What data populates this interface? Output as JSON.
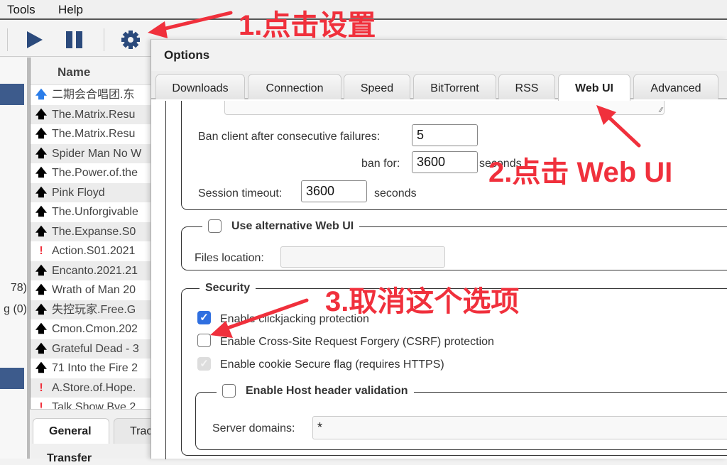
{
  "menu": {
    "items": [
      "Tools",
      "Help"
    ]
  },
  "toolbar": {
    "play": "play-icon",
    "pause": "pause-icon",
    "settings": "gear-icon"
  },
  "sidebar": {
    "count_a": "78)",
    "count_b": "g (0)"
  },
  "list": {
    "header": "Name",
    "rows": [
      {
        "status": "up-blue",
        "name": "二期会合唱团.东"
      },
      {
        "status": "up",
        "name": "The.Matrix.Resu"
      },
      {
        "status": "up",
        "name": "The.Matrix.Resu"
      },
      {
        "status": "up",
        "name": "Spider Man No W"
      },
      {
        "status": "up",
        "name": "The.Power.of.the"
      },
      {
        "status": "up",
        "name": "Pink Floyd"
      },
      {
        "status": "up",
        "name": "The.Unforgivable"
      },
      {
        "status": "up",
        "name": "The.Expanse.S0"
      },
      {
        "status": "error",
        "name": "Action.S01.2021"
      },
      {
        "status": "up",
        "name": "Encanto.2021.21"
      },
      {
        "status": "up",
        "name": "Wrath of Man 20"
      },
      {
        "status": "up",
        "name": "失控玩家.Free.G"
      },
      {
        "status": "up",
        "name": "Cmon.Cmon.202"
      },
      {
        "status": "up",
        "name": "Grateful Dead - 3"
      },
      {
        "status": "up",
        "name": "71 Into the Fire 2"
      },
      {
        "status": "error",
        "name": "A.Store.of.Hope."
      },
      {
        "status": "error",
        "name": "Talk Show Bye 2"
      }
    ]
  },
  "bottom": {
    "tabs": [
      "General",
      "Trac"
    ],
    "section": "Transfer"
  },
  "dialog": {
    "title": "Options",
    "tabs": [
      "Downloads",
      "Connection",
      "Speed",
      "BitTorrent",
      "RSS",
      "Web UI",
      "Advanced"
    ],
    "active_tab": "Web UI",
    "ban_failures_label": "Ban client after consecutive failures:",
    "ban_failures_value": "5",
    "ban_for_label": "ban for:",
    "ban_for_value": "3600",
    "ban_for_unit": "seconds",
    "session_timeout_label": "Session timeout:",
    "session_timeout_value": "3600",
    "session_timeout_unit": "seconds",
    "alt_webui_label": "Use alternative Web UI",
    "alt_webui_checked": false,
    "files_location_label": "Files location:",
    "files_location_value": "",
    "security_legend": "Security",
    "clickjacking_label": "Enable clickjacking protection",
    "clickjacking_checked": true,
    "csrf_label": "Enable Cross-Site Request Forgery (CSRF) protection",
    "csrf_checked": false,
    "cookie_secure_label": "Enable cookie Secure flag (requires HTTPS)",
    "cookie_secure_checked": true,
    "host_validation_label": "Enable Host header validation",
    "host_validation_checked": false,
    "server_domains_label": "Server domains:",
    "server_domains_value": "*"
  },
  "annotations": {
    "step1": "1.点击设置",
    "step2": "2.点击 Web UI",
    "step3": "3.取消这个选项",
    "color": "#f0303c"
  },
  "colors": {
    "selection": "#3d5b8c",
    "checkbox": "#2f6fe0",
    "icon": "#2b4a7c"
  }
}
